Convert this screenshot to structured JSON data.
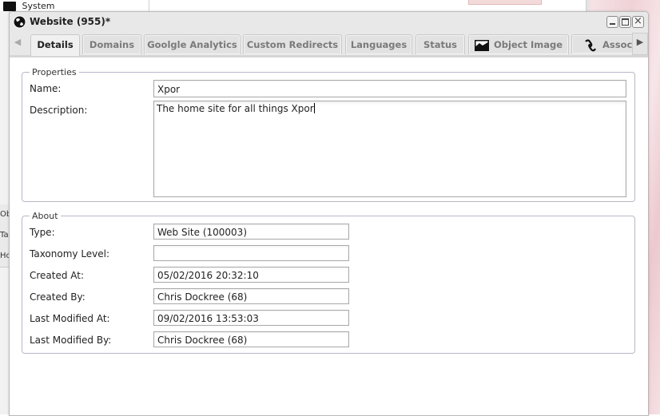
{
  "background": {
    "tree_items": [
      {
        "label": "System",
        "icon": "folder-icon"
      }
    ],
    "left_tabs": [
      "Obj",
      "Tax",
      "Hol"
    ]
  },
  "window": {
    "title": "Website (955)*",
    "icon": "globe-gear-icon",
    "controls": {
      "minimize": "minimize",
      "maximize": "maximize",
      "close": "close"
    },
    "tabs": [
      {
        "label": "Details",
        "active": true
      },
      {
        "label": "Domains"
      },
      {
        "label": "Goolgle Analytics"
      },
      {
        "label": "Custom Redirects"
      },
      {
        "label": "Languages"
      },
      {
        "label": "Status"
      },
      {
        "label": "Object Image",
        "icon": "image-icon"
      },
      {
        "label": "Associ",
        "icon": "link-icon"
      }
    ]
  },
  "properties": {
    "legend": "Properties",
    "name_label": "Name:",
    "name_value": "Xpor",
    "description_label": "Description:",
    "description_value": "The home site for all things Xpor"
  },
  "about": {
    "legend": "About",
    "fields": [
      {
        "label": "Type:",
        "value": "Web Site (100003)"
      },
      {
        "label": "Taxonomy Level:",
        "value": ""
      },
      {
        "label": "Created At:",
        "value": "05/02/2016 20:32:10"
      },
      {
        "label": "Created By:",
        "value": "Chris Dockree (68)"
      },
      {
        "label": "Last Modified At:",
        "value": "09/02/2016 13:53:03"
      },
      {
        "label": "Last Modified By:",
        "value": "Chris Dockree (68)"
      }
    ]
  }
}
